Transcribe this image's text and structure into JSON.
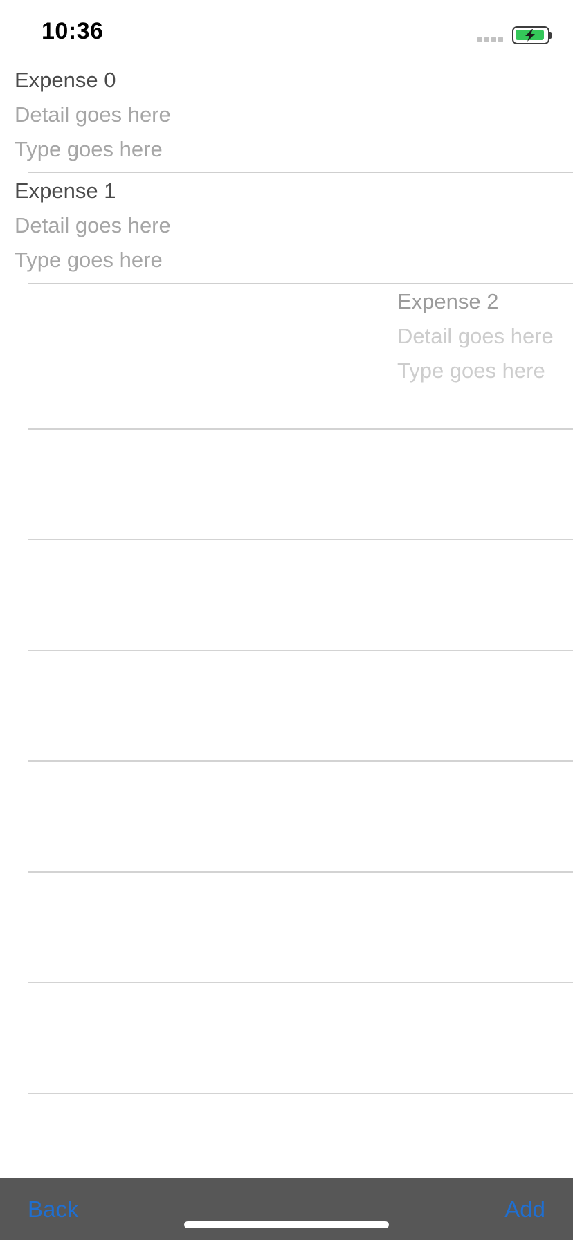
{
  "status_bar": {
    "time": "10:36",
    "battery_color": "#34c759",
    "signal_icon": "cellular-signal-icon",
    "battery_icon": "battery-charging-icon"
  },
  "expenses": [
    {
      "title": "Expense 0",
      "detail": "Detail goes here",
      "type": "Type goes here"
    },
    {
      "title": "Expense 1",
      "detail": "Detail goes here",
      "type": "Type goes here"
    },
    {
      "title": "Expense 2",
      "detail": "Detail goes here",
      "type": "Type goes here"
    }
  ],
  "toolbar": {
    "back_label": "Back",
    "add_label": "Add",
    "background": "#575757",
    "button_color": "#1f6fd1"
  }
}
